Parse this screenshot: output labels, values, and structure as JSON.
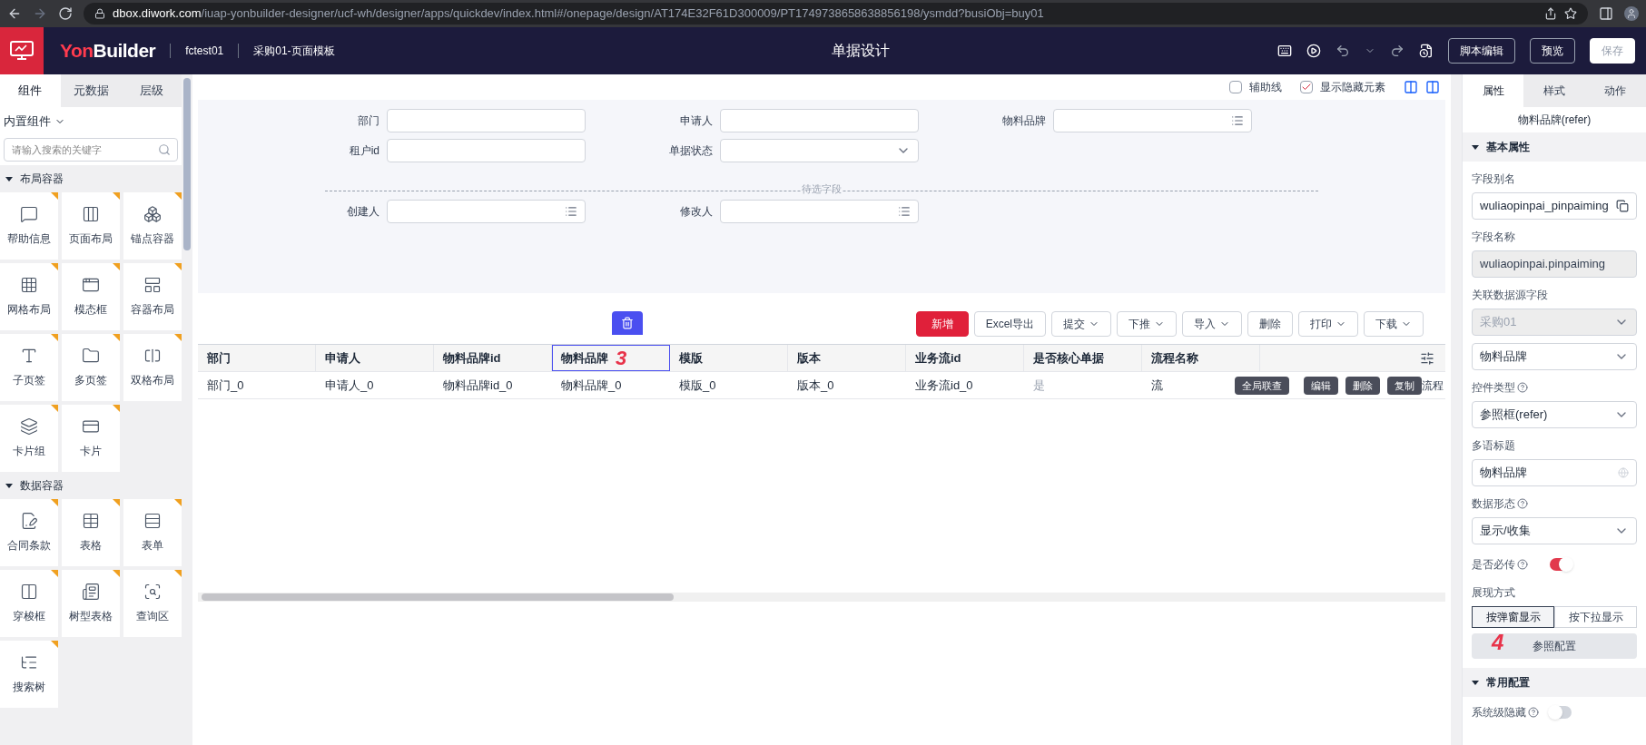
{
  "browser": {
    "url_host": "dbox.diwork.com",
    "url_path": "/iuap-yonbuilder-designer/ucf-wh/designer/apps/quickdev/index.html#/onepage/design/AT174E32F61D300009/PT1749738658638856198/ysmdd?busiObj=buy01"
  },
  "header": {
    "logo": "YonBuilder",
    "app": "fctest01",
    "page": "采购01-页面模板",
    "title": "单据设计",
    "buttons": [
      {
        "label": "脚本编辑",
        "disabled": false
      },
      {
        "label": "预览",
        "disabled": false
      },
      {
        "label": "保存",
        "disabled": true
      }
    ]
  },
  "left_panel": {
    "tabs": [
      {
        "label": "组件",
        "selected": true
      },
      {
        "label": "元数据",
        "selected": false
      },
      {
        "label": "层级",
        "selected": false
      }
    ],
    "dropdown": "内置组件",
    "search_placeholder": "请输入搜索的关键字",
    "groups": [
      {
        "title": "布局容器",
        "items": [
          {
            "label": "帮助信息",
            "kind": "help"
          },
          {
            "label": "页面布局",
            "kind": "page"
          },
          {
            "label": "锚点容器",
            "kind": "anchor"
          },
          {
            "label": "网格布局",
            "kind": "grid"
          },
          {
            "label": "模态框",
            "kind": "modal"
          },
          {
            "label": "容器布局",
            "kind": "container"
          },
          {
            "label": "子页签",
            "kind": "subtab"
          },
          {
            "label": "多页签",
            "kind": "tabs"
          },
          {
            "label": "双格布局",
            "kind": "split"
          },
          {
            "label": "卡片组",
            "kind": "cards"
          },
          {
            "label": "卡片",
            "kind": "card"
          }
        ]
      },
      {
        "title": "数据容器",
        "items": [
          {
            "label": "合同条款",
            "kind": "contract"
          },
          {
            "label": "表格",
            "kind": "table"
          },
          {
            "label": "表单",
            "kind": "form"
          },
          {
            "label": "穿梭框",
            "kind": "transfer"
          },
          {
            "label": "树型表格",
            "kind": "treetable"
          },
          {
            "label": "查询区",
            "kind": "query"
          },
          {
            "label": "搜索树",
            "kind": "searchtree"
          }
        ]
      }
    ]
  },
  "canvas_toolbar": {
    "options": [
      {
        "label": "辅助线",
        "checked": false
      },
      {
        "label": "显示隐藏元素",
        "checked": true
      }
    ]
  },
  "filter_form": {
    "rows": [
      [
        {
          "label": "部门",
          "kind": "text"
        },
        {
          "label": "申请人",
          "kind": "text"
        },
        {
          "label": "物料品牌",
          "kind": "refer"
        }
      ],
      [
        {
          "label": "租户id",
          "kind": "text"
        },
        {
          "label": "单据状态",
          "kind": "select"
        }
      ]
    ],
    "divider_label": "待选字段",
    "pending_rows": [
      [
        {
          "label": "创建人",
          "kind": "refer"
        },
        {
          "label": "修改人",
          "kind": "refer"
        }
      ]
    ]
  },
  "table_toolbar": [
    {
      "label": "新增",
      "primary": true,
      "dropdown": false
    },
    {
      "label": "Excel导出",
      "primary": false,
      "dropdown": false
    },
    {
      "label": "提交",
      "primary": false,
      "dropdown": true
    },
    {
      "label": "下推",
      "primary": false,
      "dropdown": true
    },
    {
      "label": "导入",
      "primary": false,
      "dropdown": true
    },
    {
      "label": "删除",
      "primary": false,
      "dropdown": false
    },
    {
      "label": "打印",
      "primary": false,
      "dropdown": true
    },
    {
      "label": "下载",
      "primary": false,
      "dropdown": true
    }
  ],
  "table": {
    "columns": [
      {
        "label": "部门",
        "selected": false
      },
      {
        "label": "申请人",
        "selected": false
      },
      {
        "label": "物料品牌id",
        "selected": false
      },
      {
        "label": "物料品牌",
        "selected": true
      },
      {
        "label": "模版",
        "selected": false
      },
      {
        "label": "版本",
        "selected": false
      },
      {
        "label": "业务流id",
        "selected": false
      },
      {
        "label": "是否核心单据",
        "selected": false
      },
      {
        "label": "流程名称",
        "selected": false
      }
    ],
    "rows": [
      [
        "部门_0",
        "申请人_0",
        "物料品牌id_0",
        "物料品牌_0",
        "模版_0",
        "版本_0",
        "业务流id_0",
        "是",
        "流"
      ]
    ],
    "row_actions": [
      "全局联查",
      "编辑",
      "删除",
      "复制"
    ],
    "row_overflow": "流程"
  },
  "annotations": [
    "3",
    "4"
  ],
  "right_panel": {
    "tabs": [
      {
        "label": "属性",
        "selected": true
      },
      {
        "label": "样式",
        "selected": false
      },
      {
        "label": "动作",
        "selected": false
      }
    ],
    "subtitle": "物料品牌(refer)",
    "sections": [
      {
        "title": "基本属性",
        "expanded": true
      },
      {
        "title": "常用配置",
        "expanded": true
      }
    ],
    "fields": [
      {
        "label": "字段别名",
        "kind": "copy",
        "value": "wuliaopinpai_pinpaiming",
        "disabled": false
      },
      {
        "label": "字段名称",
        "kind": "readonly",
        "value": "wuliaopinpai.pinpaiming",
        "disabled": true
      },
      {
        "label": "关联数据源字段",
        "kind": "select2",
        "value": "采购01",
        "value2": "物料品牌",
        "disabled": true
      },
      {
        "label": "控件类型",
        "kind": "select",
        "value": "参照框(refer)",
        "help": true,
        "disabled": false
      },
      {
        "label": "多语标题",
        "kind": "lang",
        "value": "物料品牌",
        "disabled": false
      },
      {
        "label": "数据形态",
        "kind": "select",
        "value": "显示/收集",
        "help": true,
        "disabled": false
      },
      {
        "label": "是否必传",
        "kind": "switch",
        "on": true,
        "help": true
      },
      {
        "label": "展现方式",
        "kind": "segment",
        "options": [
          {
            "label": "按弹窗显示",
            "selected": true
          },
          {
            "label": "按下拉显示",
            "selected": false
          }
        ]
      },
      {
        "kind": "button",
        "label": "参照配置"
      }
    ],
    "last_field": {
      "label": "系统级隐藏",
      "help": true,
      "on": false
    }
  }
}
